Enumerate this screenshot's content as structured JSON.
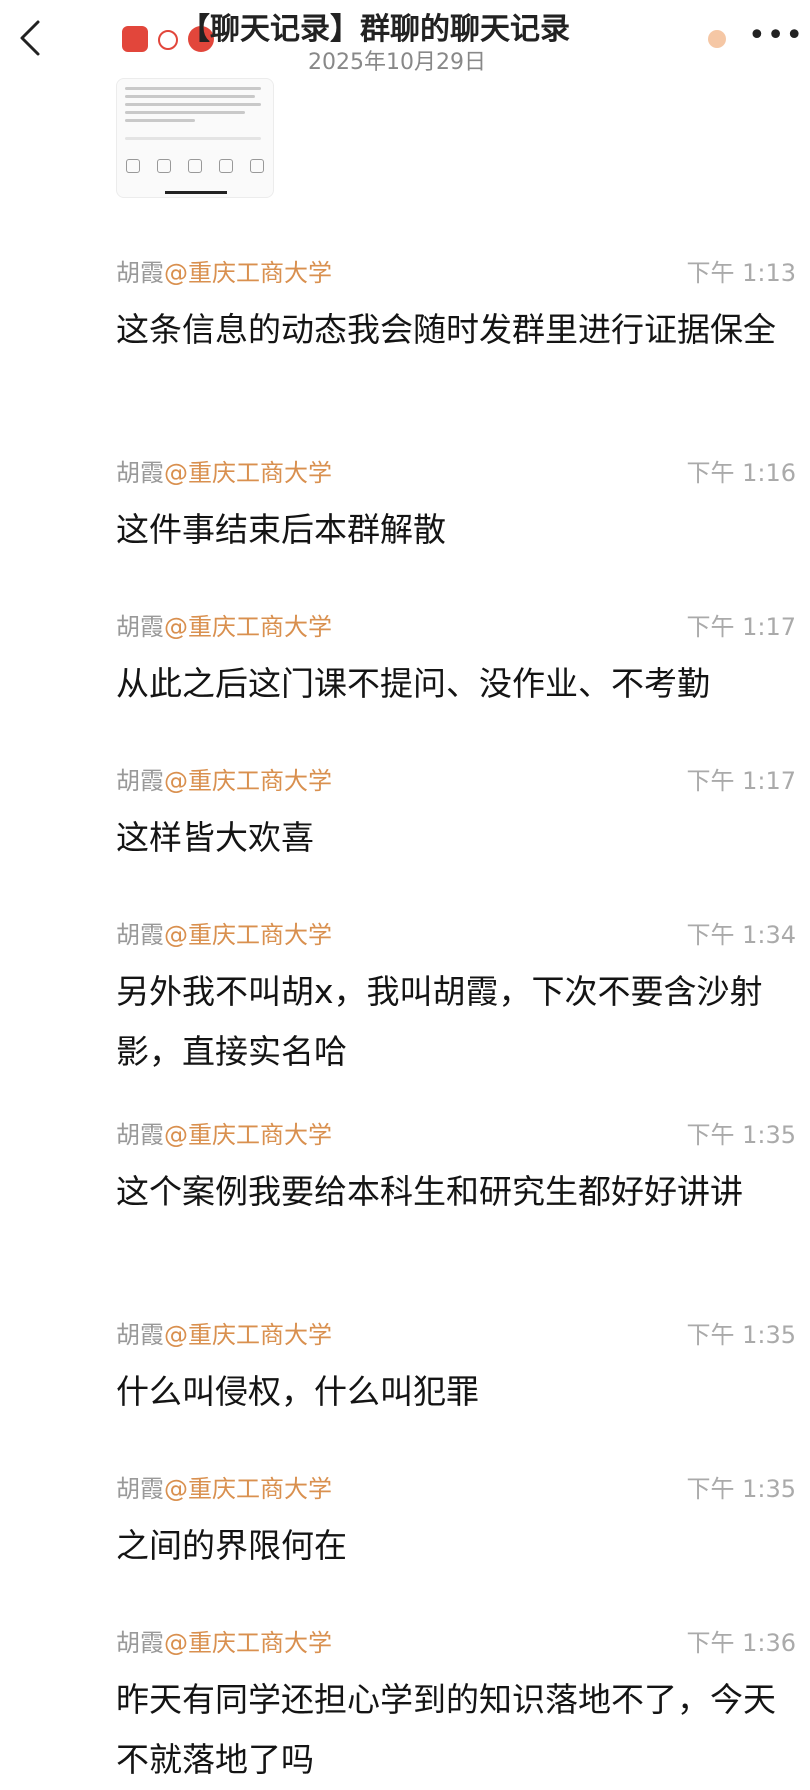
{
  "header": {
    "title": "【聊天记录】群聊的聊天记录",
    "date": "2025年10月29日"
  },
  "messages": [
    {
      "name": "胡霞",
      "org": "@重庆工商大学",
      "time": "下午 1:13",
      "text": "这条信息的动态我会随时发群里进行证据保全"
    },
    {
      "name": "胡霞",
      "org": "@重庆工商大学",
      "time": "下午 1:16",
      "text": "这件事结束后本群解散"
    },
    {
      "name": "胡霞",
      "org": "@重庆工商大学",
      "time": "下午 1:17",
      "text": "从此之后这门课不提问、没作业、不考勤"
    },
    {
      "name": "胡霞",
      "org": "@重庆工商大学",
      "time": "下午 1:17",
      "text": "这样皆大欢喜"
    },
    {
      "name": "胡霞",
      "org": "@重庆工商大学",
      "time": "下午 1:34",
      "text": "另外我不叫胡x，我叫胡霞，下次不要含沙射影，直接实名哈"
    },
    {
      "name": "胡霞",
      "org": "@重庆工商大学",
      "time": "下午 1:35",
      "text": "这个案例我要给本科生和研究生都好好讲讲"
    },
    {
      "name": "胡霞",
      "org": "@重庆工商大学",
      "time": "下午 1:35",
      "text": "什么叫侵权，什么叫犯罪"
    },
    {
      "name": "胡霞",
      "org": "@重庆工商大学",
      "time": "下午 1:35",
      "text": "之间的界限何在"
    },
    {
      "name": "胡霞",
      "org": "@重庆工商大学",
      "time": "下午 1:36",
      "text": "昨天有同学还担心学到的知识落地不了，今天不就落地了吗"
    }
  ],
  "icons": {
    "back": "chevron-left-icon",
    "more": "more-dots-icon"
  },
  "colors": {
    "org": "#d9904f",
    "muted": "#999999"
  }
}
